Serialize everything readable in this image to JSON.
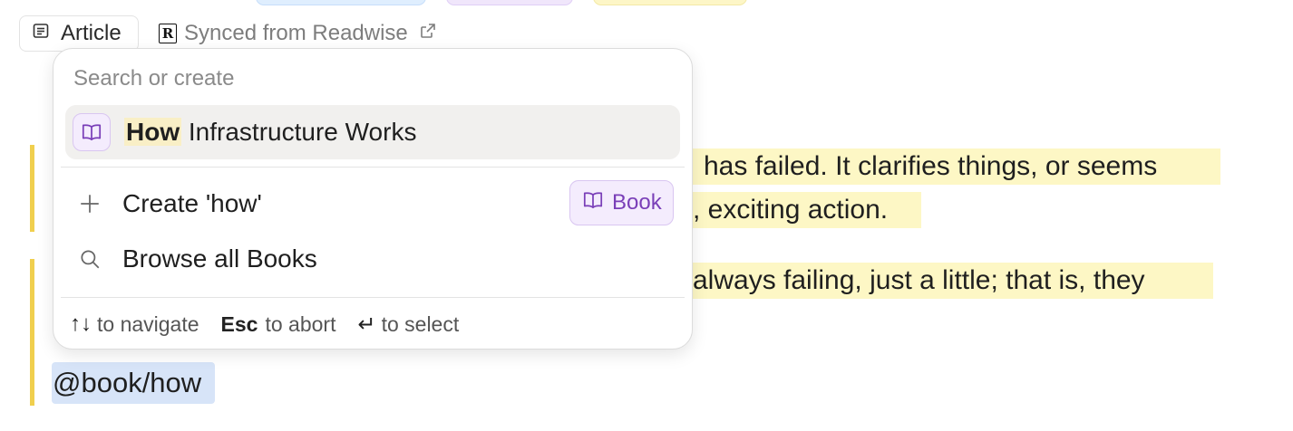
{
  "header": {
    "type_chip_label": "Article",
    "synced_label": "Synced from Readwise",
    "readwise_logo_letter": "R"
  },
  "document": {
    "highlight_lines": [
      "has failed. It clarifies things, or seems",
      ", exciting action.",
      "always failing, just a little; that is, they"
    ],
    "mention_text": "@book/how"
  },
  "popover": {
    "search": {
      "placeholder": "Search or create",
      "value": ""
    },
    "result": {
      "match_text": "How",
      "rest_text": " Infrastructure Works"
    },
    "create_label": "Create 'how'",
    "create_type_label": "Book",
    "browse_label": "Browse all Books",
    "footer": {
      "navigate_keys": "↑↓",
      "navigate_text": "to navigate",
      "abort_key": "Esc",
      "abort_text": "to abort",
      "select_key": "↵",
      "select_text": "to select"
    }
  },
  "colors": {
    "highlight": "#fdf7c5",
    "quote_bar": "#f0cf4e",
    "book_accent": "#7a3fb8",
    "mention_bg": "#d7e4f8"
  }
}
